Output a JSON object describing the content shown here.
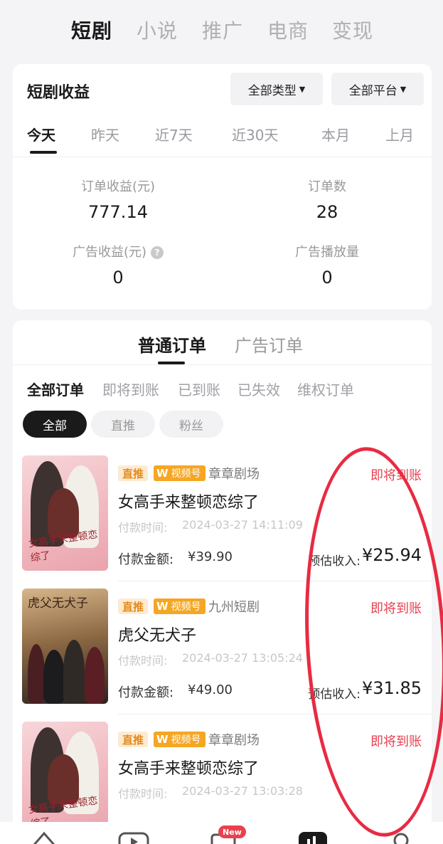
{
  "top_tabs": [
    {
      "label": "短剧",
      "active": true
    },
    {
      "label": "小说",
      "active": false
    },
    {
      "label": "推广",
      "active": false
    },
    {
      "label": "电商",
      "active": false
    },
    {
      "label": "变现",
      "active": false
    }
  ],
  "earnings": {
    "title": "短剧收益",
    "filter_type": "全部类型",
    "filter_platform": "全部平台",
    "periods": [
      "今天",
      "昨天",
      "近7天",
      "近30天",
      "本月",
      "上月"
    ],
    "active_period": "今天",
    "stats": {
      "order_revenue_label": "订单收益(元)",
      "order_revenue_value": "777.14",
      "order_count_label": "订单数",
      "order_count_value": "28",
      "ad_revenue_label": "广告收益(元)",
      "ad_revenue_value": "0",
      "ad_plays_label": "广告播放量",
      "ad_plays_value": "0"
    }
  },
  "orders": {
    "type_tabs": [
      "普通订单",
      "广告订单"
    ],
    "status_tabs": [
      "全部订单",
      "即将到账",
      "已到账",
      "已失效",
      "维权订单"
    ],
    "pills": [
      "全部",
      "直推",
      "粉丝"
    ],
    "pay_time_label": "付款时间:",
    "pay_amount_label": "付款金额:",
    "est_income_label": "预估收入:",
    "badge_direct": "直推",
    "badge_channel": "视频号",
    "items": [
      {
        "studio": "章章剧场",
        "title": "女高手来整顿恋综了",
        "status": "即将到账",
        "pay_time": "2024-03-27 14:11:09",
        "amount": "¥39.90",
        "income": "¥25.94",
        "poster_text": "女高手来整顿恋综了"
      },
      {
        "studio": "九州短剧",
        "title": "虎父无犬子",
        "status": "即将到账",
        "pay_time": "2024-03-27 13:05:24",
        "amount": "¥49.00",
        "income": "¥31.85",
        "poster_text": "虎父无犬子"
      },
      {
        "studio": "章章剧场",
        "title": "女高手来整顿恋综了",
        "status": "即将到账",
        "pay_time": "2024-03-27 13:03:28",
        "amount": "",
        "income": "",
        "poster_text": "女高手来整顿恋综了"
      }
    ]
  },
  "bottom_nav": {
    "new_badge": "New"
  },
  "colors": {
    "status_red": "#e8414f",
    "annotation_red": "#e82b42",
    "badge_orange": "#f5a623"
  }
}
